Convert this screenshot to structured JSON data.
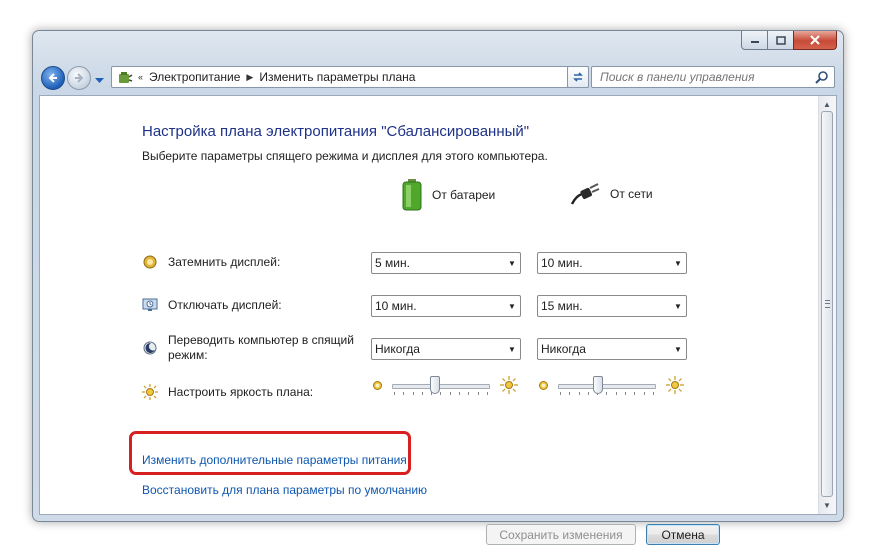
{
  "window": {
    "caption_buttons": [
      "minimize",
      "maximize",
      "close"
    ]
  },
  "navigation": {
    "breadcrumbs": [
      "Электропитание",
      "Изменить параметры плана"
    ],
    "search_placeholder": "Поиск в панели управления"
  },
  "page": {
    "title": "Настройка плана электропитания \"Сбалансированный\"",
    "subtitle": "Выберите параметры спящего режима и дисплея для этого компьютера.",
    "columns": {
      "battery": "От батареи",
      "plugged": "От сети"
    },
    "settings": [
      {
        "label": "Затемнить дисплей:",
        "icon": "dim-display-icon",
        "battery": "5 мин.",
        "plugged": "10 мин."
      },
      {
        "label": "Отключать дисплей:",
        "icon": "display-off-icon",
        "battery": "10 мин.",
        "plugged": "15 мин."
      },
      {
        "label_line1": "Переводить компьютер в спящий",
        "label_line2": "режим:",
        "icon": "sleep-icon",
        "battery": "Никогда",
        "plugged": "Никогда"
      }
    ],
    "brightness": {
      "label": "Настроить яркость плана:",
      "battery_level": 0.45,
      "plugged_level": 0.42
    },
    "links": {
      "advanced": "Изменить дополнительные параметры питания",
      "restore": "Восстановить для плана параметры по умолчанию"
    },
    "buttons": {
      "save": "Сохранить изменения",
      "cancel": "Отмена"
    }
  },
  "colors": {
    "title": "#1e3287",
    "link": "#0e57b0",
    "highlight": "#d72121"
  }
}
